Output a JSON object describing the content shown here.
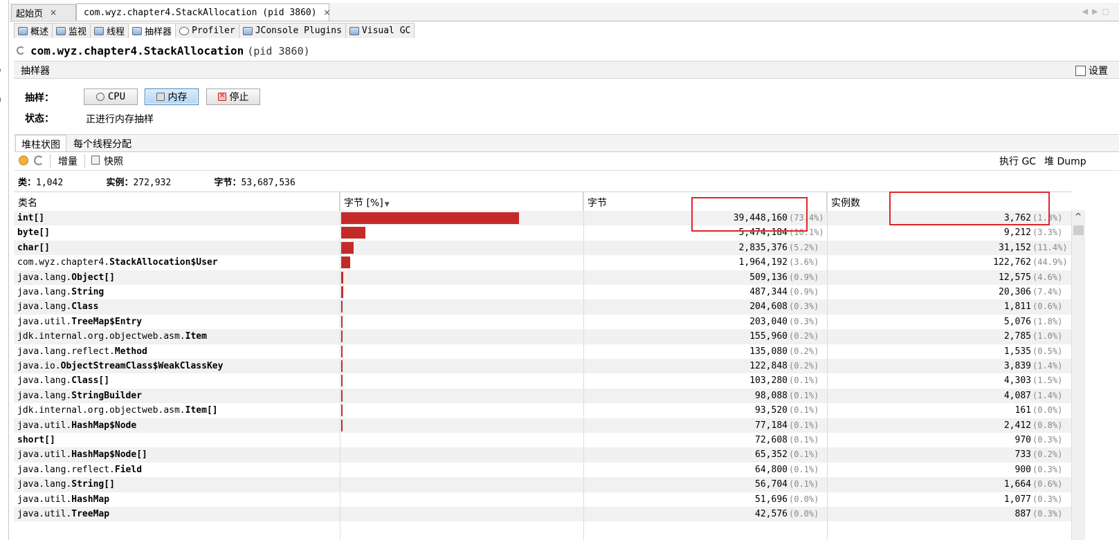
{
  "doc_tabs": [
    {
      "label": "起始页",
      "close": "×"
    },
    {
      "label": "com.wyz.chapter4.StackAllocation (pid 3860)",
      "close": "×"
    }
  ],
  "app_tabs": [
    "概述",
    "监视",
    "线程",
    "抽样器",
    "Profiler",
    "JConsole Plugins",
    "Visual GC"
  ],
  "left_fragments": [
    "–",
    "o",
    "i",
    "n"
  ],
  "header": {
    "app_name": "com.wyz.chapter4.StackAllocation",
    "pid": "(pid 3860)"
  },
  "sampler": {
    "title": "抽样器",
    "settings_label": "设置",
    "sample_label": "抽样：",
    "buttons": {
      "cpu": "CPU",
      "memory": "内存",
      "stop": "停止"
    },
    "status_label": "状态：",
    "status_value": "正进行内存抽样"
  },
  "view_tabs": [
    "堆柱状图",
    "每个线程分配"
  ],
  "toolbar": {
    "delta": "增量",
    "snapshot": "快照",
    "perform_gc": "执行 GC",
    "heap_dump": "堆 Dump"
  },
  "summary": {
    "classes_label": "类：",
    "classes_value": "1,042",
    "instances_label": "实例：",
    "instances_value": "272,932",
    "bytes_label": "字节：",
    "bytes_value": "53,687,536"
  },
  "table": {
    "columns": {
      "name": "类名",
      "bar": "字节 [%]",
      "bytes": "字节",
      "instances": "实例数"
    },
    "sort_indicator": "▼",
    "rows": [
      {
        "prefix": "",
        "cls": "int[]",
        "bytes": "39,448,160",
        "bytes_pct": "(73.4%)",
        "pct_value": 73.4,
        "instances": "3,762",
        "inst_pct": "(1.3%)"
      },
      {
        "prefix": "",
        "cls": "byte[]",
        "bytes": "5,474,184",
        "bytes_pct": "(10.1%)",
        "pct_value": 10.1,
        "instances": "9,212",
        "inst_pct": "(3.3%)"
      },
      {
        "prefix": "",
        "cls": "char[]",
        "bytes": "2,835,376",
        "bytes_pct": "(5.2%)",
        "pct_value": 5.2,
        "instances": "31,152",
        "inst_pct": "(11.4%)"
      },
      {
        "prefix": "com.wyz.chapter4.",
        "cls": "StackAllocation$User",
        "bytes": "1,964,192",
        "bytes_pct": "(3.6%)",
        "pct_value": 3.6,
        "instances": "122,762",
        "inst_pct": "(44.9%)"
      },
      {
        "prefix": "java.lang.",
        "cls": "Object[]",
        "bytes": "509,136",
        "bytes_pct": "(0.9%)",
        "pct_value": 0.9,
        "instances": "12,575",
        "inst_pct": "(4.6%)"
      },
      {
        "prefix": "java.lang.",
        "cls": "String",
        "bytes": "487,344",
        "bytes_pct": "(0.9%)",
        "pct_value": 0.9,
        "instances": "20,306",
        "inst_pct": "(7.4%)"
      },
      {
        "prefix": "java.lang.",
        "cls": "Class",
        "bytes": "204,608",
        "bytes_pct": "(0.3%)",
        "pct_value": 0.3,
        "instances": "1,811",
        "inst_pct": "(0.6%)"
      },
      {
        "prefix": "java.util.",
        "cls": "TreeMap$Entry",
        "bytes": "203,040",
        "bytes_pct": "(0.3%)",
        "pct_value": 0.3,
        "instances": "5,076",
        "inst_pct": "(1.8%)"
      },
      {
        "prefix": "jdk.internal.org.objectweb.asm.",
        "cls": "Item",
        "bytes": "155,960",
        "bytes_pct": "(0.2%)",
        "pct_value": 0.2,
        "instances": "2,785",
        "inst_pct": "(1.0%)"
      },
      {
        "prefix": "java.lang.reflect.",
        "cls": "Method",
        "bytes": "135,080",
        "bytes_pct": "(0.2%)",
        "pct_value": 0.2,
        "instances": "1,535",
        "inst_pct": "(0.5%)"
      },
      {
        "prefix": "java.io.",
        "cls": "ObjectStreamClass$WeakClassKey",
        "bytes": "122,848",
        "bytes_pct": "(0.2%)",
        "pct_value": 0.2,
        "instances": "3,839",
        "inst_pct": "(1.4%)"
      },
      {
        "prefix": "java.lang.",
        "cls": "Class[]",
        "bytes": "103,280",
        "bytes_pct": "(0.1%)",
        "pct_value": 0.1,
        "instances": "4,303",
        "inst_pct": "(1.5%)"
      },
      {
        "prefix": "java.lang.",
        "cls": "StringBuilder",
        "bytes": "98,088",
        "bytes_pct": "(0.1%)",
        "pct_value": 0.1,
        "instances": "4,087",
        "inst_pct": "(1.4%)"
      },
      {
        "prefix": "jdk.internal.org.objectweb.asm.",
        "cls": "Item[]",
        "bytes": "93,520",
        "bytes_pct": "(0.1%)",
        "pct_value": 0.1,
        "instances": "161",
        "inst_pct": "(0.0%)"
      },
      {
        "prefix": "java.util.",
        "cls": "HashMap$Node",
        "bytes": "77,184",
        "bytes_pct": "(0.1%)",
        "pct_value": 0.1,
        "instances": "2,412",
        "inst_pct": "(0.8%)"
      },
      {
        "prefix": "",
        "cls": "short[]",
        "bytes": "72,608",
        "bytes_pct": "(0.1%)",
        "pct_value": 0.0,
        "instances": "970",
        "inst_pct": "(0.3%)"
      },
      {
        "prefix": "java.util.",
        "cls": "HashMap$Node[]",
        "bytes": "65,352",
        "bytes_pct": "(0.1%)",
        "pct_value": 0.0,
        "instances": "733",
        "inst_pct": "(0.2%)"
      },
      {
        "prefix": "java.lang.reflect.",
        "cls": "Field",
        "bytes": "64,800",
        "bytes_pct": "(0.1%)",
        "pct_value": 0.0,
        "instances": "900",
        "inst_pct": "(0.3%)"
      },
      {
        "prefix": "java.lang.",
        "cls": "String[]",
        "bytes": "56,704",
        "bytes_pct": "(0.1%)",
        "pct_value": 0.0,
        "instances": "1,664",
        "inst_pct": "(0.6%)"
      },
      {
        "prefix": "java.util.",
        "cls": "HashMap",
        "bytes": "51,696",
        "bytes_pct": "(0.0%)",
        "pct_value": 0.0,
        "instances": "1,077",
        "inst_pct": "(0.3%)"
      },
      {
        "prefix": "java.util.",
        "cls": "TreeMap",
        "bytes": "42,576",
        "bytes_pct": "(0.0%)",
        "pct_value": 0.0,
        "instances": "887",
        "inst_pct": "(0.3%)"
      }
    ]
  },
  "colors": {
    "bar": "#c42a2a",
    "highlight": "#e0232b",
    "selected": "#3a77c7"
  }
}
